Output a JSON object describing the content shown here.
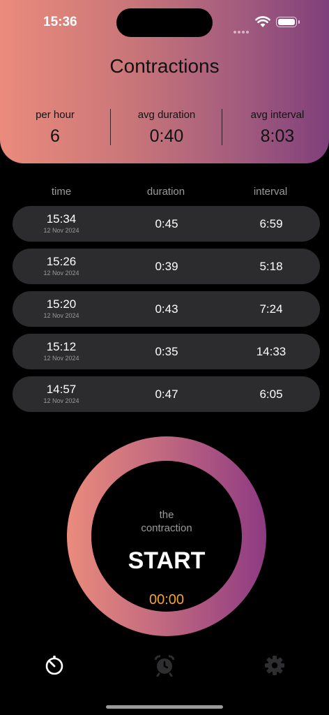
{
  "status_bar": {
    "time": "15:36"
  },
  "header": {
    "title": "Contractions",
    "stats": [
      {
        "label": "per hour",
        "value": "6"
      },
      {
        "label": "avg duration",
        "value": "0:40"
      },
      {
        "label": "avg interval",
        "value": "8:03"
      }
    ]
  },
  "table": {
    "columns": [
      "time",
      "duration",
      "interval"
    ],
    "rows": [
      {
        "time": "15:34",
        "date": "12 Nov 2024",
        "duration": "0:45",
        "interval": "6:59"
      },
      {
        "time": "15:26",
        "date": "12 Nov 2024",
        "duration": "0:39",
        "interval": "5:18"
      },
      {
        "time": "15:20",
        "date": "12 Nov 2024",
        "duration": "0:43",
        "interval": "7:24"
      },
      {
        "time": "15:12",
        "date": "12 Nov 2024",
        "duration": "0:35",
        "interval": "14:33"
      },
      {
        "time": "14:57",
        "date": "12 Nov 2024",
        "duration": "0:47",
        "interval": "6:05"
      }
    ]
  },
  "control": {
    "subtitle_line1": "the",
    "subtitle_line2": "contraction",
    "button_label": "START",
    "timer": "00:00"
  },
  "tabbar": {
    "items": [
      {
        "icon": "timer-icon",
        "active": true
      },
      {
        "icon": "alarm-clock-icon",
        "active": false
      },
      {
        "icon": "gear-icon",
        "active": false
      }
    ]
  },
  "colors": {
    "accent_timer": "#f5a623",
    "gradient_start": "#ea8b7c",
    "gradient_end": "#7f3f7a",
    "row_bg": "#2c2c2e"
  }
}
